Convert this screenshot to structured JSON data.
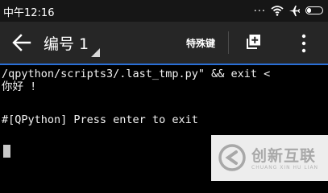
{
  "status_bar": {
    "time": "中午12:16",
    "dots": "...",
    "icons": [
      "wifi-icon",
      "airplane-icon",
      "battery-icon"
    ]
  },
  "app_bar": {
    "title": "编号 1",
    "special_keys_label": "特殊键",
    "icons": [
      "back-arrow-icon",
      "add-tab-icon",
      "overflow-menu-icon"
    ],
    "accent_color": "#2a6fd6"
  },
  "terminal": {
    "lines": [
      "/qpython/scripts3/.last_tmp.py\" && exit <",
      "你好 !",
      "",
      "#[QPython] Press enter to exit"
    ]
  },
  "watermark": {
    "name": "创新互联",
    "subtitle": "CHUANG XIN HU LIAN"
  }
}
